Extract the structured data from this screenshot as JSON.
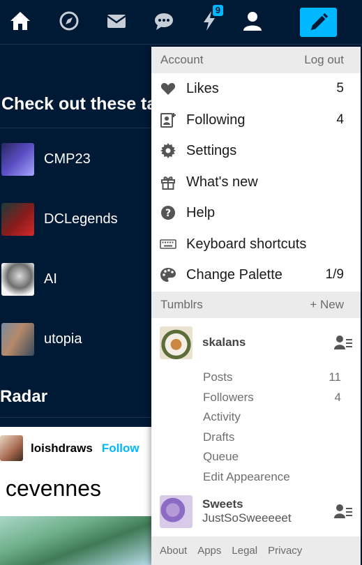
{
  "nav": {
    "items": [
      {
        "icon": "home-icon"
      },
      {
        "icon": "explore-icon"
      },
      {
        "icon": "inbox-icon"
      },
      {
        "icon": "messages-icon"
      },
      {
        "icon": "activity-icon",
        "badge": "9"
      },
      {
        "icon": "account-icon"
      }
    ],
    "compose_icon": "pencil-icon",
    "accent": "#00b8ff",
    "background": "#001935"
  },
  "feed": {
    "heading": "Check out these tags",
    "tags": [
      {
        "label": "CMP23"
      },
      {
        "label": "DCLegends"
      },
      {
        "label": "AI"
      },
      {
        "label": "utopia"
      }
    ],
    "radar_heading": "Radar",
    "post": {
      "username": "loishdraws",
      "follow_label": "Follow",
      "title": "cevennes"
    }
  },
  "menu": {
    "account_header": {
      "title": "Account",
      "action": "Log out"
    },
    "items": [
      {
        "label": "Likes",
        "count": "5",
        "icon": "heart-icon"
      },
      {
        "label": "Following",
        "count": "4",
        "icon": "following-icon"
      },
      {
        "label": "Settings",
        "count": "",
        "icon": "gear-icon"
      },
      {
        "label": "What's new",
        "count": "",
        "icon": "gift-icon"
      },
      {
        "label": "Help",
        "count": "",
        "icon": "help-icon"
      },
      {
        "label": "Keyboard shortcuts",
        "count": "",
        "icon": "keyboard-icon"
      },
      {
        "label": "Change Palette",
        "count": "1/9",
        "icon": "palette-icon"
      }
    ],
    "tumblrs_header": {
      "title": "Tumblrs",
      "action": "+ New"
    },
    "blogs": [
      {
        "name": "skalans",
        "title": "",
        "stats": [
          {
            "label": "Posts",
            "value": "11"
          },
          {
            "label": "Followers",
            "value": "4"
          },
          {
            "label": "Activity",
            "value": ""
          },
          {
            "label": "Drafts",
            "value": ""
          },
          {
            "label": "Queue",
            "value": ""
          },
          {
            "label": "Edit Appearence",
            "value": ""
          }
        ]
      },
      {
        "name": "Sweets",
        "title": "JustSoSweeeeet"
      }
    ],
    "footer": [
      "About",
      "Apps",
      "Legal",
      "Privacy"
    ]
  }
}
